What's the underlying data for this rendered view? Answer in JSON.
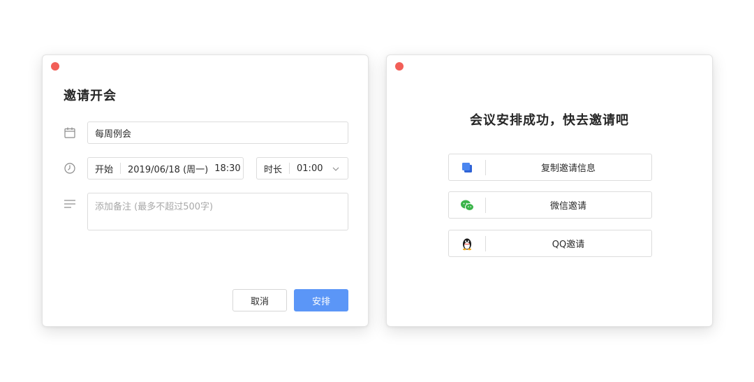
{
  "colors": {
    "close_dot": "#f25f58",
    "primary": "#5b96f7",
    "wechat_green": "#3bb44a",
    "copy_blue": "#4a86f0"
  },
  "invite_dialog": {
    "title": "邀请开会",
    "icons": [
      "calendar-icon",
      "clock-icon",
      "note-lines-icon",
      "chevron-down-icon"
    ],
    "meeting_title_value": "每周例会",
    "start_label": "开始",
    "start_date": "2019/06/18 (周一)",
    "start_time": "18:30",
    "duration_label": "时长",
    "duration_value": "01:00",
    "note_placeholder": "添加备注 (最多不超过500字)",
    "cancel_label": "取消",
    "confirm_label": "安排"
  },
  "success_dialog": {
    "title": "会议安排成功，快去邀请吧",
    "options": [
      {
        "label": "复制邀请信息",
        "icon": "copy-icon"
      },
      {
        "label": "微信邀请",
        "icon": "wechat-icon"
      },
      {
        "label": "QQ邀请",
        "icon": "qq-icon"
      }
    ]
  }
}
